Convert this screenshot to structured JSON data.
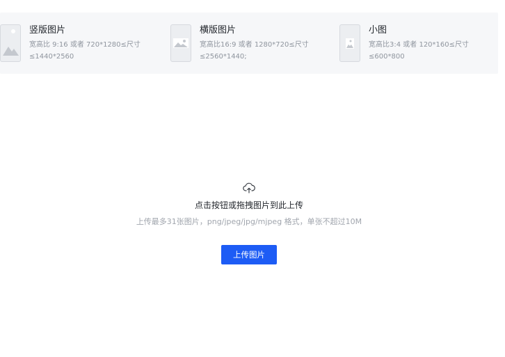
{
  "specs": [
    {
      "title": "竖版图片",
      "desc": "宽高比 9:16 或者 720*1280≤尺寸≤1440*2560",
      "icon": "portrait-image-icon"
    },
    {
      "title": "横版图片",
      "desc": "宽高比16:9 或者 1280*720≤尺寸≤2560*1440;",
      "icon": "landscape-image-icon"
    },
    {
      "title": "小图",
      "desc": "宽高比3:4 或者 120*160≤尺寸≤600*800",
      "icon": "small-image-icon"
    }
  ],
  "upload": {
    "icon": "cloud-upload-icon",
    "title": "点击按钮或拖拽图片到此上传",
    "hint": "上传最多31张图片，png/jpeg/jpg/mjpeg 格式，单张不超过10M",
    "button_label": "上传图片"
  },
  "colors": {
    "accent": "#1d5cf5",
    "spec_bar_bg": "#f6f7f9",
    "muted_text": "#a0a5ad"
  }
}
